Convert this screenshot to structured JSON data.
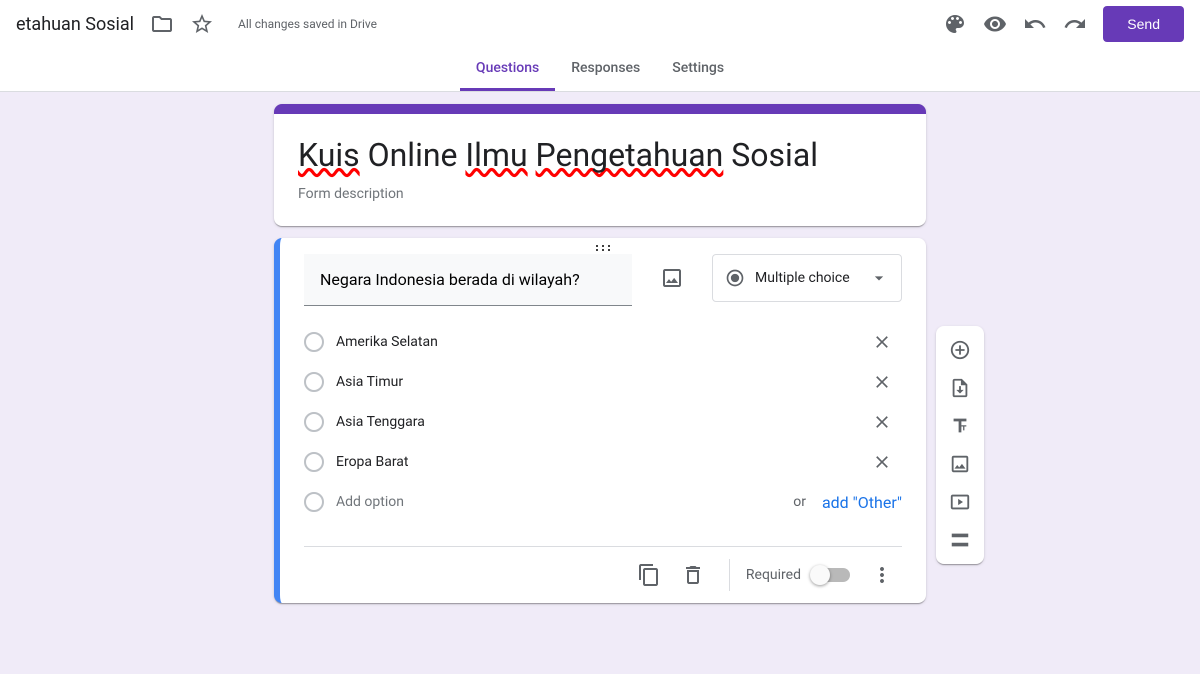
{
  "header": {
    "title_visible": "etahuan Sosial",
    "save_status": "All changes saved in Drive",
    "send_label": "Send"
  },
  "tabs": {
    "questions": "Questions",
    "responses": "Responses",
    "settings": "Settings"
  },
  "form": {
    "title_parts": [
      "Kuis",
      " Online ",
      "Ilmu",
      " ",
      "Pengetahuan",
      " Sosial"
    ],
    "description_placeholder": "Form description"
  },
  "question": {
    "text": "Negara Indonesia berada di wilayah?",
    "type_label": "Multiple choice",
    "options": [
      "Amerika Selatan",
      "Asia Timur",
      "Asia Tenggara",
      "Eropa Barat"
    ],
    "add_option_label": "Add option",
    "or_label": "or",
    "add_other_label": "add \"Other\"",
    "required_label": "Required"
  }
}
